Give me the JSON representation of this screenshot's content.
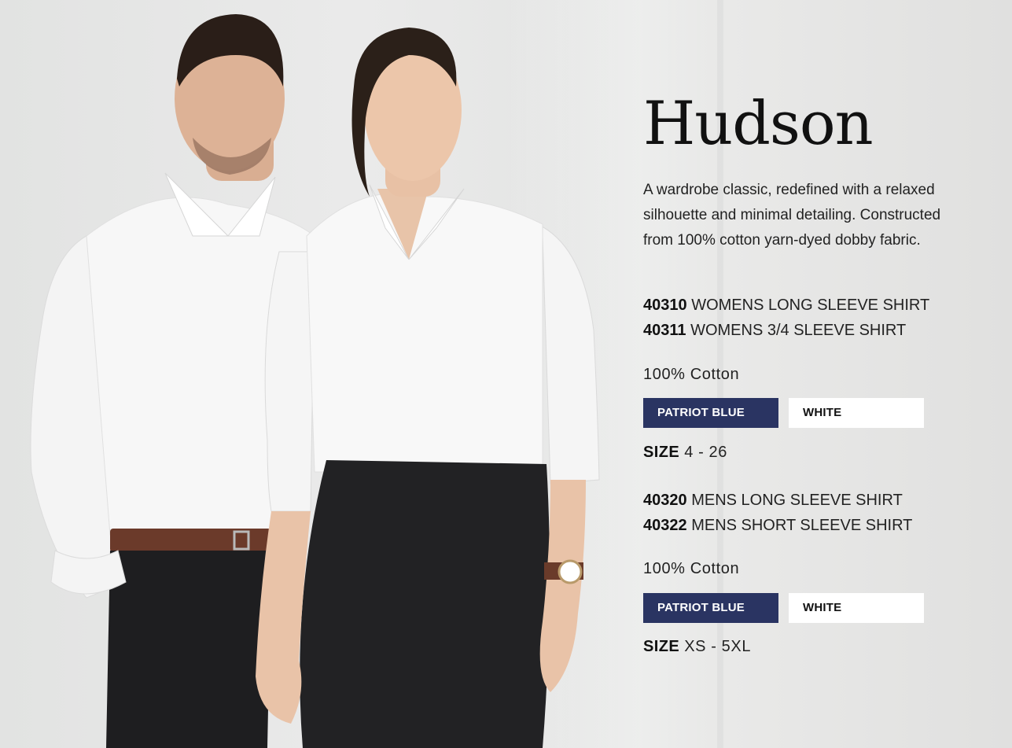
{
  "title": "Hudson",
  "description": "A wardrobe classic, redefined with a relaxed silhouette and minimal detailing. Constructed from 100% cotton yarn-dyed dobby fabric.",
  "womens": {
    "products": [
      {
        "code": "40310",
        "name": "WOMENS LONG SLEEVE SHIRT"
      },
      {
        "code": "40311",
        "name": "WOMENS 3/4 SLEEVE SHIRT"
      }
    ],
    "fabric": "100% Cotton",
    "colours": [
      {
        "label": "PATRIOT BLUE",
        "hex": "#2a3462"
      },
      {
        "label": "WHITE",
        "hex": "#ffffff"
      }
    ],
    "size_label": "SIZE",
    "size_range": "4 - 26"
  },
  "mens": {
    "products": [
      {
        "code": "40320",
        "name": "MENS LONG SLEEVE SHIRT"
      },
      {
        "code": "40322",
        "name": "MENS SHORT SLEEVE SHIRT"
      }
    ],
    "fabric": "100% Cotton",
    "colours": [
      {
        "label": "PATRIOT BLUE",
        "hex": "#2a3462"
      },
      {
        "label": "WHITE",
        "hex": "#ffffff"
      }
    ],
    "size_label": "SIZE",
    "size_range": "XS - 5XL"
  },
  "colors": {
    "accent": "#2a3462",
    "background": "#e6e6e5",
    "text": "#1a1a1a"
  }
}
